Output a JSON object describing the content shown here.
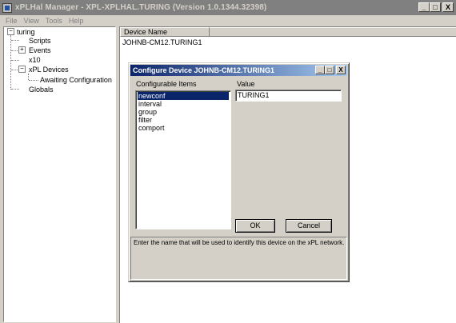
{
  "window": {
    "title": "xPLHal Manager - XPL-XPLHAL.TURING (Version 1.0.1344.32398)",
    "minimize": "_",
    "maximize": "□",
    "close": "X"
  },
  "menu": {
    "items": [
      {
        "label": "File"
      },
      {
        "label": "View"
      },
      {
        "label": "Tools"
      },
      {
        "label": "Help"
      }
    ]
  },
  "tree": {
    "root": {
      "label": "turing",
      "expander": "−"
    },
    "items": [
      {
        "label": "Scripts"
      },
      {
        "label": "Events",
        "expander": "+"
      },
      {
        "label": "x10"
      },
      {
        "label": "xPL Devices",
        "expander": "−"
      },
      {
        "label": "Awaiting Configuration"
      },
      {
        "label": "Globals"
      }
    ]
  },
  "list": {
    "column_header": "Device Name",
    "rows": [
      {
        "device_name": "JOHNB-CM12.TURING1"
      }
    ]
  },
  "dialog": {
    "title": "Configure Device JOHNB-CM12.TURING1",
    "minimize": "_",
    "maximize": "□",
    "close": "X",
    "items_label": "Configurable Items",
    "value_label": "Value",
    "items": [
      {
        "label": "newconf"
      },
      {
        "label": "interval"
      },
      {
        "label": "group"
      },
      {
        "label": "filter"
      },
      {
        "label": "comport"
      }
    ],
    "selected_index": 0,
    "value": "TURING1",
    "ok_label": "OK",
    "cancel_label": "Cancel",
    "help_text": "Enter the name that will be used to identify this device on the xPL network."
  },
  "colors": {
    "selection": "#0a246a",
    "inactive_titlebar": "#808080",
    "dialog_titlebar_start": "#0a246a",
    "dialog_titlebar_end": "#a6caf0",
    "face": "#d4d0c8"
  }
}
